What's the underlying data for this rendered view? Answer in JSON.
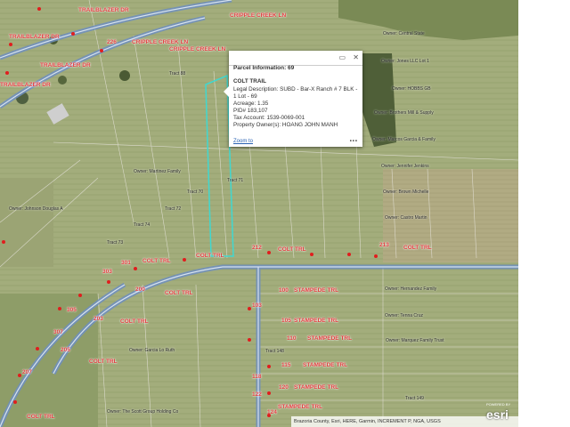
{
  "popup": {
    "title": "Parcel Information: 69",
    "name": "COLT TRAIL",
    "legal": "Legal Description: SUBD - Bar-X Ranch # 7 BLK - 1 Lot - 69",
    "acreage": "Acreage: 1.35",
    "pid": "PID# 183,107",
    "tax_account": "Tax Account: 1539-0069-001",
    "owner": "Property Owner(s): HOANG JOHN MANH",
    "zoom_label": "Zoom to",
    "more_label": "•••"
  },
  "attribution": "Brazoria County, Esri, HERE, Garmin, INCREMENT P, NGA, USGS",
  "powered_by": "POWERED BY",
  "esri_logo": "esri",
  "colors": {
    "parcel_label": "#e03b3b",
    "selected_parcel": "#40d8d0",
    "road": "#7fa0c8"
  },
  "road_labels": [
    "CRIPPLE CREEK LN",
    "CRIPPLE CREEK LN",
    "CRIPPLE CREEK LN",
    "TRAILBLAZER DR",
    "TRAILBLAZER DR",
    "TRAILBLAZER DR",
    "TRAILBLAZER DR",
    "COLT TRL",
    "COLT TRL",
    "COLT TRL",
    "COLT TRL",
    "COLT TRL",
    "COLT TRL",
    "COLT TRL",
    "COLT TRL",
    "STAMPEDE TRL",
    "STAMPEDE TRL",
    "STAMPEDE TRL",
    "STAMPEDE TRL",
    "STAMPEDE TRL",
    "STAMPEDE TRL"
  ],
  "numbers": [
    "225",
    "226",
    "212",
    "213",
    "301",
    "303",
    "305",
    "307",
    "200",
    "203",
    "205",
    "207",
    "100",
    "103",
    "105",
    "110",
    "115",
    "118",
    "120",
    "122",
    "124"
  ],
  "owners": [
    "Owner: Central State",
    "Owner: Jones LLC Lot 1",
    "Owner: HOBBS GB",
    "Owner: Brothers Mill & Supply",
    "Owner: Marcos Garcia & Family",
    "Owner: Jennifer Jenkins",
    "Owner: Brown Michelle",
    "Owner: Castro Martin",
    "Owner: Hernandez Family",
    "Owner: Tenna Cruz",
    "Owner: Marquez Family Trust",
    "Owner: Garcia Lo Ruth",
    "Owner: The Scott Group Holding Co",
    "Owner: Johnson Douglas A",
    "Owner: Martinez Family"
  ],
  "tract_labels": [
    "Tract 88",
    "Tract 71",
    "Tract 70",
    "Tract 72",
    "Tract 73",
    "Tract 74",
    "Tract 148",
    "Tract 149"
  ]
}
